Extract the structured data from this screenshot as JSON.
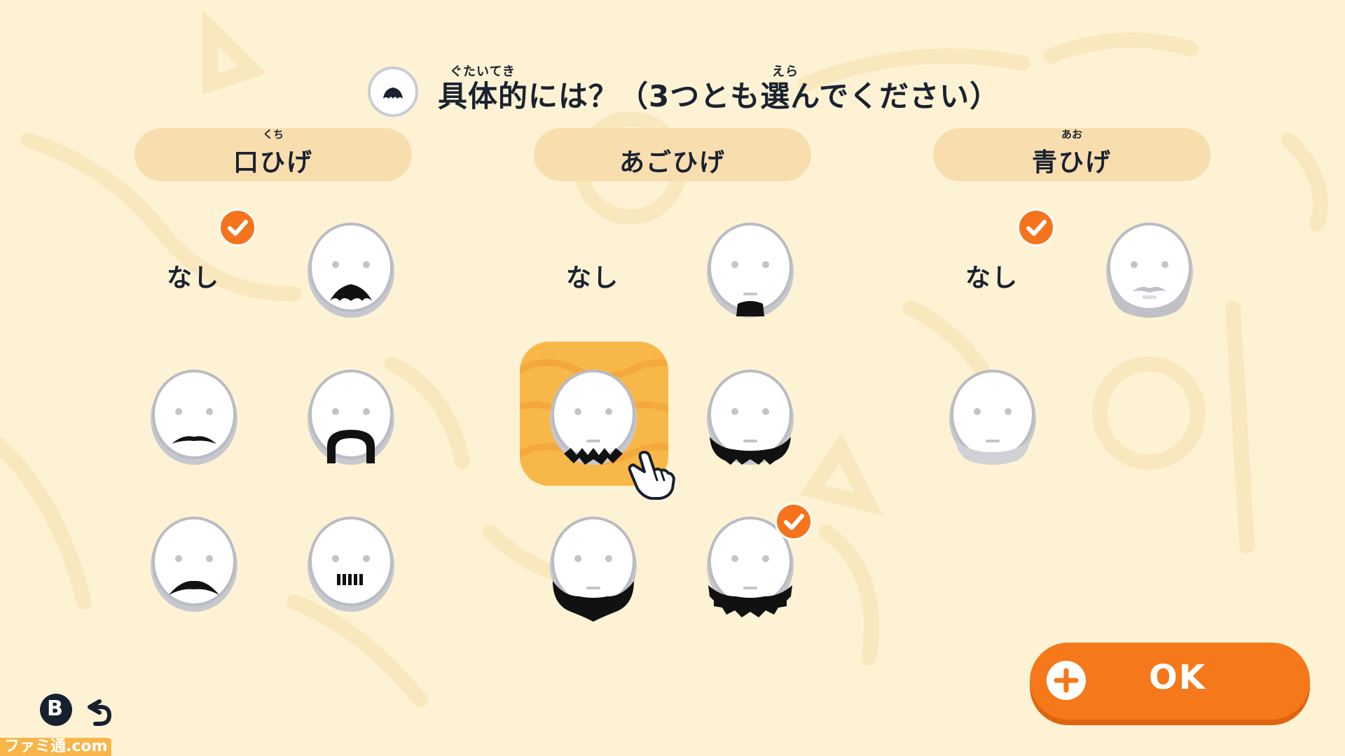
{
  "header": {
    "title": "具体的には？（3つとも選んでください）",
    "ruby_gutaiteki": "ぐたいてき",
    "ruby_erabu": "えら",
    "icon": "face-beard-icon"
  },
  "categories": [
    {
      "id": "mustache",
      "label": "口ひげ",
      "ruby": "くち",
      "options": [
        {
          "id": "none",
          "label": "なし",
          "selected": true
        },
        {
          "id": "mustache-1",
          "selected": false
        },
        {
          "id": "mustache-2",
          "selected": false
        },
        {
          "id": "mustache-3",
          "selected": false
        },
        {
          "id": "mustache-4",
          "selected": false
        },
        {
          "id": "mustache-5",
          "selected": false
        }
      ]
    },
    {
      "id": "beard",
      "label": "あごひげ",
      "ruby": "",
      "options": [
        {
          "id": "none",
          "label": "なし",
          "selected": false
        },
        {
          "id": "beard-1",
          "selected": false
        },
        {
          "id": "beard-2",
          "selected": false,
          "hovered": true
        },
        {
          "id": "beard-3",
          "selected": false
        },
        {
          "id": "beard-4",
          "selected": false
        },
        {
          "id": "beard-5",
          "selected": true
        }
      ]
    },
    {
      "id": "stubble",
      "label": "青ひげ",
      "ruby": "あお",
      "options": [
        {
          "id": "none",
          "label": "なし",
          "selected": true
        },
        {
          "id": "stubble-1",
          "selected": false
        },
        {
          "id": "stubble-2",
          "selected": false
        }
      ]
    }
  ],
  "buttons": {
    "ok_label": "OK",
    "ok_icon": "plus-icon",
    "back_button_glyph": "B",
    "back_icon": "undo-arrow-icon"
  },
  "watermark": "ファミ通.com",
  "colors": {
    "background": "#fdf3d4",
    "category_pill": "#f8deae",
    "accent_orange": "#f5781a",
    "highlight": "#f8b849",
    "text": "#1a2230"
  }
}
